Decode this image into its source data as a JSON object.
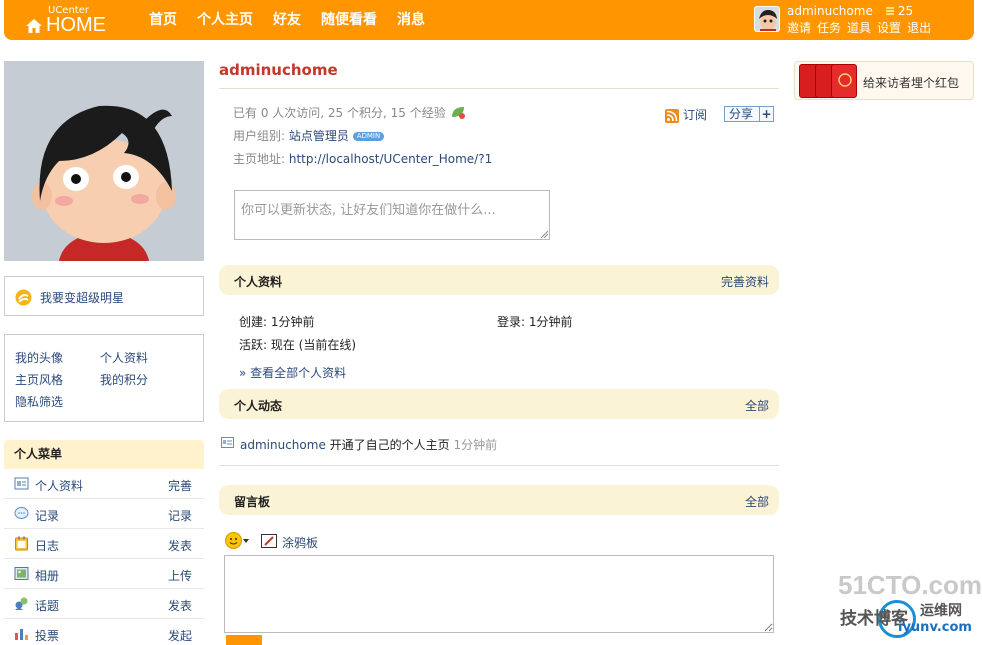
{
  "header": {
    "logo_small": "UCenter",
    "logo_big": "HOME",
    "nav": [
      "首页",
      "个人主页",
      "好友",
      "随便看看",
      "消息"
    ],
    "username": "adminuchome",
    "credit": "25",
    "user_links": [
      "邀请",
      "任务",
      "道具",
      "设置",
      "退出"
    ]
  },
  "sidebar": {
    "star_text": "我要变超级明星",
    "links": [
      "我的头像",
      "个人资料",
      "主页风格",
      "我的积分",
      "隐私筛选"
    ],
    "menu_title": "个人菜单",
    "menu": [
      {
        "label": "个人资料",
        "action": "完善",
        "icon": "profile-icon"
      },
      {
        "label": "记录",
        "action": "记录",
        "icon": "doing-icon"
      },
      {
        "label": "日志",
        "action": "发表",
        "icon": "blog-icon"
      },
      {
        "label": "相册",
        "action": "上传",
        "icon": "album-icon"
      },
      {
        "label": "话题",
        "action": "发表",
        "icon": "topic-icon"
      },
      {
        "label": "投票",
        "action": "发起",
        "icon": "poll-icon"
      }
    ]
  },
  "main": {
    "name": "adminuchome",
    "stats": "已有 0 人次访问, 25 个积分, 15 个经验",
    "group_label": "用户组别:",
    "group_value": "站点管理员",
    "group_badge": "ADMIN",
    "homepage_label": "主页地址:",
    "homepage_value": "http://localhost/UCenter_Home/?1",
    "feed_label": "订阅",
    "share_label": "分享",
    "status_placeholder": "你可以更新状态, 让好友们知道你在做什么...",
    "profile_section": {
      "title": "个人资料",
      "more": "完善资料",
      "created": "创建: 1分钟前",
      "login": "登录: 1分钟前",
      "active": "活跃: 现在 (当前在线)",
      "view_all": "» 查看全部个人资料"
    },
    "activity_section": {
      "title": "个人动态",
      "more": "全部",
      "item_user": "adminuchome",
      "item_text": " 开通了自己的个人主页 ",
      "item_time": "1分钟前"
    },
    "board_section": {
      "title": "留言板",
      "more": "全部",
      "doodle_label": "涂鸦板"
    }
  },
  "right": {
    "redpack_text": "给来访者埋个红包"
  },
  "watermark": {
    "line1": "51CTO.com",
    "line2": "技术博客",
    "line3": "运维网",
    "line4": "iyunv.com"
  },
  "colors": {
    "brand": "#ff9600",
    "section_bg": "#fbf3d5",
    "name_red": "#c0392b",
    "link": "#2b4a78"
  }
}
